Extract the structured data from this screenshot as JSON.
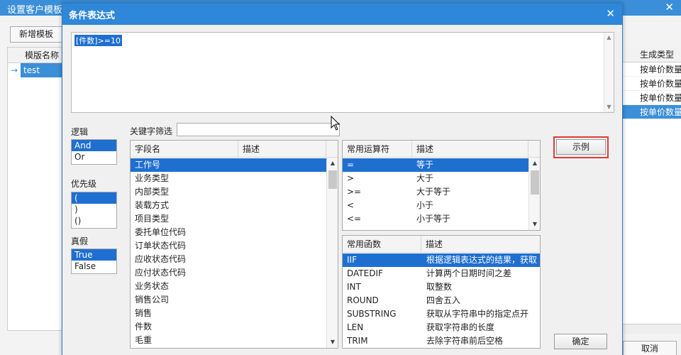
{
  "background_window": {
    "title": "设置客户模板",
    "new_template_btn": "新增模板",
    "grid_header": "模版名称",
    "row": "test",
    "right_header": "生成类型",
    "right_rows": [
      "按单价数量",
      "按单价数量",
      "按单价数量",
      "按单价数量"
    ],
    "cancel": "取消"
  },
  "dialog": {
    "title": "条件表达式",
    "expression": "[件数]>=10"
  },
  "labels": {
    "logic": "逻辑",
    "priority": "优先级",
    "truth": "真假",
    "keyword_filter": "关键字筛选"
  },
  "logic_items": [
    "And",
    "Or"
  ],
  "priority_items": [
    "(",
    ")",
    "()"
  ],
  "truth_items": [
    "True",
    "False"
  ],
  "fields_grid": {
    "headers": [
      "字段名",
      "描述"
    ],
    "rows": [
      "工作号",
      "业务类型",
      "内部类型",
      "装载方式",
      "项目类型",
      "委托单位代码",
      "订单状态代码",
      "应收状态代码",
      "应付状态代码",
      "业务状态",
      "销售公司",
      "销售",
      "件数",
      "毛重"
    ]
  },
  "operators_grid": {
    "headers": [
      "常用运算符",
      "描述"
    ],
    "rows": [
      {
        "op": "=",
        "desc": "等于"
      },
      {
        "op": ">",
        "desc": "大于"
      },
      {
        "op": ">=",
        "desc": "大于等于"
      },
      {
        "op": "<",
        "desc": "小于"
      },
      {
        "op": "<=",
        "desc": "小于等于"
      }
    ]
  },
  "functions_grid": {
    "headers": [
      "常用函数",
      "描述"
    ],
    "rows": [
      {
        "fn": "IIF",
        "desc": "根据逻辑表达式的结果，获取"
      },
      {
        "fn": "DATEDIF",
        "desc": "计算两个日期时间之差"
      },
      {
        "fn": "INT",
        "desc": "取整数"
      },
      {
        "fn": "ROUND",
        "desc": "四舍五入"
      },
      {
        "fn": "SUBSTRING",
        "desc": "获取从字符串中的指定点开"
      },
      {
        "fn": "LEN",
        "desc": "获取字符串的长度"
      },
      {
        "fn": "TRIM",
        "desc": "去除字符串前后空格"
      }
    ]
  },
  "buttons": {
    "example": "示例",
    "ok": "确定"
  },
  "colors": {
    "titlebar": "#2e87d9",
    "selection": "#1f6fd0",
    "highlight": "#e23b3b"
  }
}
